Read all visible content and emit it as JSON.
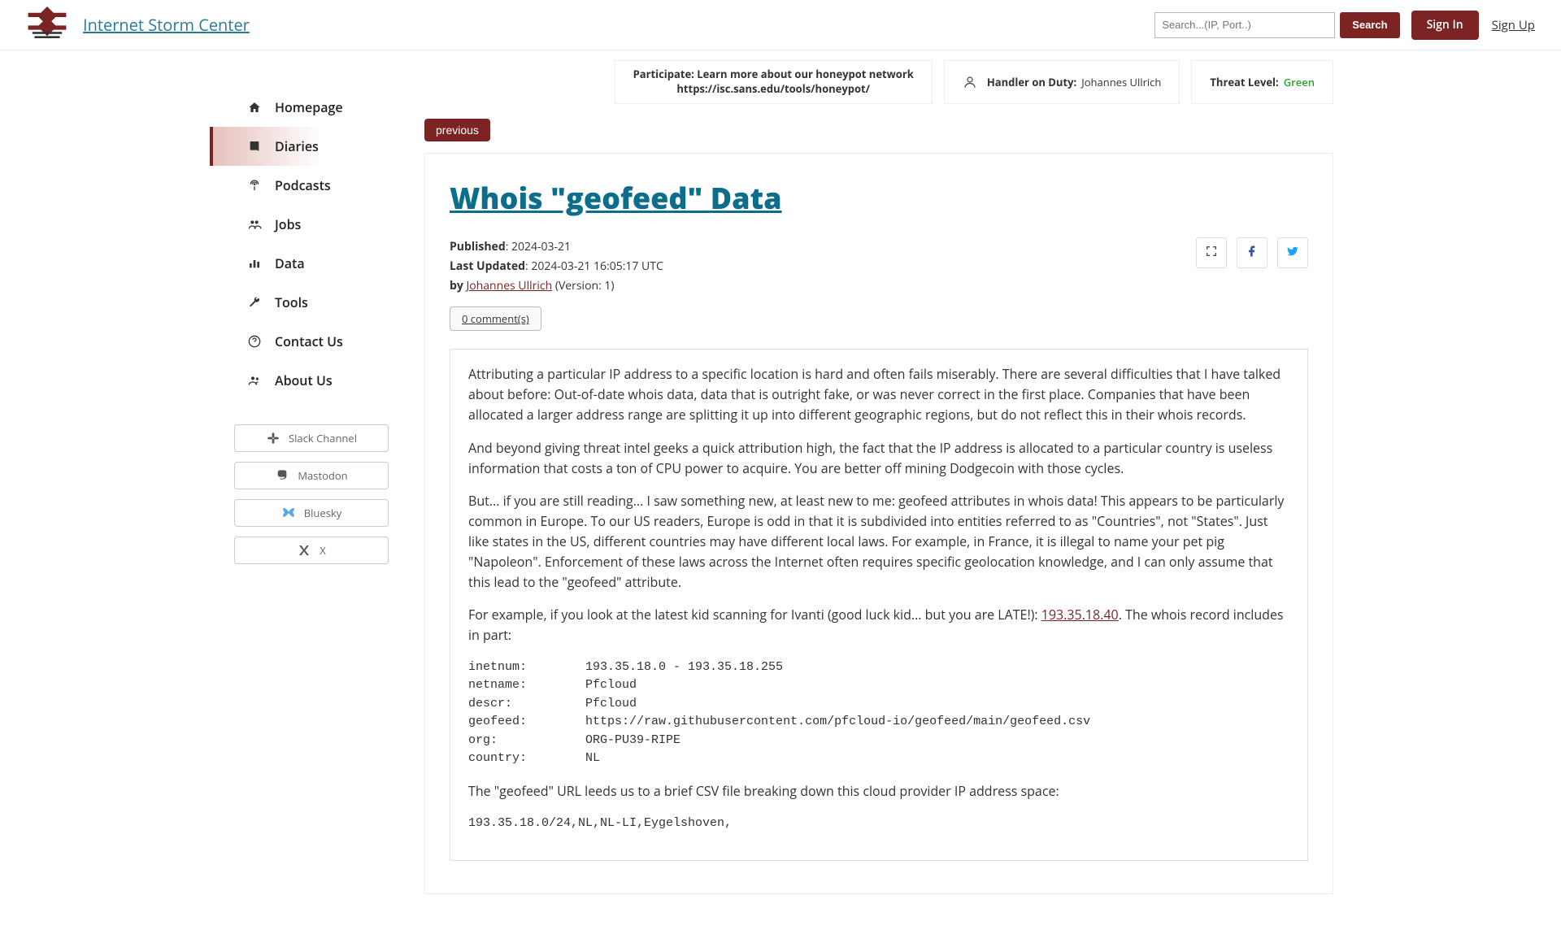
{
  "header": {
    "brand": "Internet Storm Center",
    "search_placeholder": "Search...(IP, Port..)",
    "search_button": "Search",
    "signin": "Sign In",
    "signup": "Sign Up"
  },
  "sidebar": {
    "items": [
      {
        "label": "Homepage"
      },
      {
        "label": "Diaries"
      },
      {
        "label": "Podcasts"
      },
      {
        "label": "Jobs"
      },
      {
        "label": "Data"
      },
      {
        "label": "Tools"
      },
      {
        "label": "Contact Us"
      },
      {
        "label": "About Us"
      }
    ],
    "social": [
      {
        "label": "Slack Channel"
      },
      {
        "label": "Mastodon"
      },
      {
        "label": "Bluesky"
      },
      {
        "label": "X"
      }
    ]
  },
  "info": {
    "participate_l1": "Participate: Learn more about our honeypot network",
    "participate_l2": "https://isc.sans.edu/tools/honeypot/",
    "hod_label": "Handler on Duty:",
    "hod_value": "Johannes Ullrich",
    "threat_label": "Threat Level:",
    "threat_value": "Green"
  },
  "nav": {
    "previous": "previous"
  },
  "article": {
    "title": "Whois \"geofeed\" Data",
    "published_label": "Published",
    "published_value": "2024-03-21",
    "updated_label": "Last Updated",
    "updated_value": "2024-03-21 16:05:17 UTC",
    "by_label": "by",
    "author": "Johannes Ullrich",
    "version": "(Version: 1)",
    "comments": "0 comment(s)",
    "p1": "Attributing a particular IP address to a specific location is hard and often fails miserably. There are several difficulties that I have talked about before: Out-of-date whois data, data that is outright fake, or was never correct in the first place. Companies that have been allocated a larger address range are splitting it up into different geographic regions, but do not reflect this in their whois records.",
    "p2": "And beyond giving threat intel geeks a quick attribution high, the fact that the IP address is allocated to a particular country is useless information that costs a ton of CPU power to acquire. You are better off mining Dodgecoin with those cycles.",
    "p3": "But... if you are still reading... I saw something new, at least new to me: geofeed attributes in whois data! This appears to be particularly common in Europe. To our US readers, Europe is odd in that it is subdivided into entities referred to as \"Countries\", not \"States\". Just like states in the US, different countries may have different local laws. For example, in France, it is illegal to name your pet pig \"Napoleon\". Enforcement of these laws across the Internet often requires specific geolocation knowledge, and I can only assume that this lead to the \"geofeed\" attribute.",
    "p4_a": "For example, if you look at the latest kid scanning for Ivanti (good luck kid... but you are LATE!): ",
    "p4_ip": "193.35.18.40",
    "p4_b": ". The whois record includes in part:",
    "whois": "inetnum:        193.35.18.0 - 193.35.18.255\nnetname:        Pfcloud\ndescr:          Pfcloud\ngeofeed:        https://raw.githubusercontent.com/pfcloud-io/geofeed/main/geofeed.csv\norg:            ORG-PU39-RIPE\ncountry:        NL",
    "p5": "The \"geofeed\" URL leeds us to a brief CSV file breaking down this cloud provider IP address space:",
    "csv": "193.35.18.0/24,NL,NL-LI,Eygelshoven,"
  }
}
